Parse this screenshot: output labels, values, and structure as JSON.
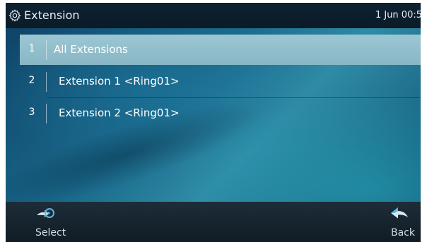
{
  "header": {
    "title": "Extension",
    "datetime": "1 Jun 00:5",
    "icon": "gear-icon"
  },
  "list": {
    "selected_index": 0,
    "items": [
      {
        "number": "1",
        "label": "All Extensions"
      },
      {
        "number": "2",
        "label": "Extension  1 <Ring01>"
      },
      {
        "number": "3",
        "label": "Extension  2 <Ring01>"
      }
    ]
  },
  "softkeys": {
    "left": {
      "label": "Select",
      "icon": "select-arrow-icon"
    },
    "right": {
      "label": "Back",
      "icon": "back-arrow-icon"
    }
  },
  "colors": {
    "selected_row": "#9cc6d3",
    "title_bar": "#0e2231",
    "softkey_bar": "#1d2d38",
    "icon_accent": "#5ab8e0"
  }
}
